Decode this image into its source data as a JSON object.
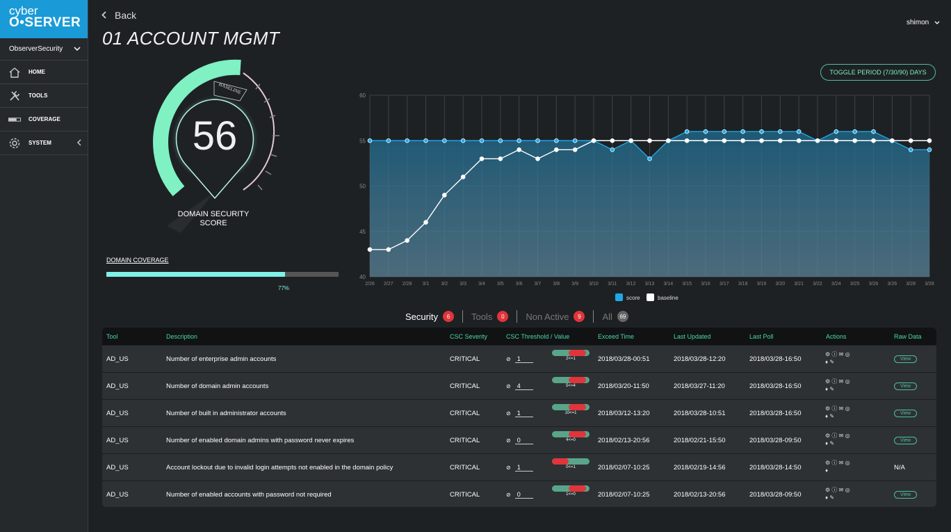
{
  "brand": {
    "line1": "cyber",
    "line2": "O•SERVER"
  },
  "org": "ObserverSecurity",
  "nav": [
    {
      "label": "HOME",
      "icon": "home-icon"
    },
    {
      "label": "TOOLS",
      "icon": "tools-icon"
    },
    {
      "label": "COVERAGE",
      "icon": "coverage-icon"
    },
    {
      "label": "SYSTEM",
      "icon": "gear-icon"
    }
  ],
  "header": {
    "back": "Back",
    "title": "01 ACCOUNT MGMT",
    "user": "shimon"
  },
  "gauge": {
    "score": "56",
    "label_line1": "DOMAIN SECURITY",
    "label_line2": "SCORE",
    "baseline_label": "BASELINE",
    "score_value": 56,
    "baseline_value": 55,
    "color": "#7ff1c2"
  },
  "coverage": {
    "label": "DOMAIN COVERAGE",
    "percent_text": "77%",
    "percent": 77,
    "color": "#7ff1e8"
  },
  "toggle_label": "TOGGLE PERIOD (7/30/90) DAYS",
  "chart_data": {
    "type": "line",
    "x": [
      "2/26",
      "2/27",
      "2/28",
      "3/1",
      "3/2",
      "3/3",
      "3/4",
      "3/5",
      "3/6",
      "3/7",
      "3/8",
      "3/9",
      "3/10",
      "3/11",
      "3/12",
      "3/13",
      "3/14",
      "3/15",
      "3/16",
      "3/17",
      "3/18",
      "3/19",
      "3/20",
      "3/21",
      "3/22",
      "3/24",
      "3/25",
      "3/26",
      "3/26",
      "3/28",
      "3/28"
    ],
    "series": [
      {
        "name": "score",
        "color": "#1ea8e8",
        "values": [
          55,
          55,
          55,
          55,
          55,
          55,
          55,
          55,
          55,
          55,
          55,
          55,
          55,
          54,
          55,
          53,
          55,
          56,
          56,
          56,
          56,
          56,
          56,
          56,
          55,
          56,
          56,
          56,
          55,
          54,
          54
        ]
      },
      {
        "name": "baseline",
        "color": "#ffffff",
        "values": [
          43,
          43,
          44,
          46,
          49,
          51,
          53,
          53,
          54,
          53,
          54,
          54,
          55,
          55,
          55,
          55,
          55,
          55,
          55,
          55,
          55,
          55,
          55,
          55,
          55,
          55,
          55,
          55,
          55,
          55,
          55
        ]
      }
    ],
    "ylim": [
      40,
      60
    ],
    "yticks": [
      40,
      45,
      50,
      55,
      60
    ],
    "grid": true,
    "legend": "bottom"
  },
  "tabs": [
    {
      "label": "Security",
      "count": "6",
      "active": true
    },
    {
      "label": "Tools",
      "count": "0"
    },
    {
      "label": "Non Active",
      "count": "9"
    },
    {
      "label": "All",
      "count": "69"
    }
  ],
  "table": {
    "headers": [
      "Tool",
      "Description",
      "CSC Severity",
      "CSC Threshold / Value",
      "Exceed Time",
      "Last Updated",
      "Last Poll",
      "Actions",
      "Raw Data"
    ],
    "rows": [
      {
        "tool": "AD_US",
        "desc": "Number of enterprise admin accounts",
        "sev": "CRITICAL",
        "thr": "1",
        "bar": "2<=1",
        "red": 0.45,
        "redLeft": 0.45,
        "exceed": "2018/03/28-00:51",
        "updated": "2018/03/28-12:20",
        "poll": "2018/03/28-16:50",
        "raw": "View"
      },
      {
        "tool": "AD_US",
        "desc": "Number of domain admin accounts",
        "sev": "CRITICAL",
        "thr": "4",
        "bar": "5<=4",
        "red": 0.45,
        "redLeft": 0.45,
        "exceed": "2018/03/20-11:50",
        "updated": "2018/03/27-11:20",
        "poll": "2018/03/28-16:50",
        "raw": "View"
      },
      {
        "tool": "AD_US",
        "desc": "Number of built in administrator accounts",
        "sev": "CRITICAL",
        "thr": "1",
        "bar": "10<=1",
        "red": 0.45,
        "redLeft": 0.45,
        "exceed": "2018/03/12-13:20",
        "updated": "2018/03/28-10:51",
        "poll": "2018/03/28-16:50",
        "raw": "View"
      },
      {
        "tool": "AD_US",
        "desc": "Number of enabled domain admins with password never expires",
        "sev": "CRITICAL",
        "thr": "0",
        "bar": "4<=0",
        "red": 0.45,
        "redLeft": 0.45,
        "exceed": "2018/02/13-20:56",
        "updated": "2018/02/21-15:50",
        "poll": "2018/03/28-09:50",
        "raw": "View"
      },
      {
        "tool": "AD_US",
        "desc": "Account lockout due to invalid login attempts not enabled in the domain policy",
        "sev": "CRITICAL",
        "thr": "1",
        "bar": "0<=1",
        "red": 0.45,
        "redLeft": 0.0,
        "exceed": "2018/02/07-10:25",
        "updated": "2018/02/19-14:56",
        "poll": "2018/03/28-14:50",
        "raw": "N/A"
      },
      {
        "tool": "AD_US",
        "desc": "Number of enabled accounts with password not required",
        "sev": "CRITICAL",
        "thr": "0",
        "bar": "1<=0",
        "red": 0.45,
        "redLeft": 0.45,
        "exceed": "2018/02/07-10:25",
        "updated": "2018/02/13-20:56",
        "poll": "2018/03/28-09:50",
        "raw": "View"
      }
    ]
  }
}
